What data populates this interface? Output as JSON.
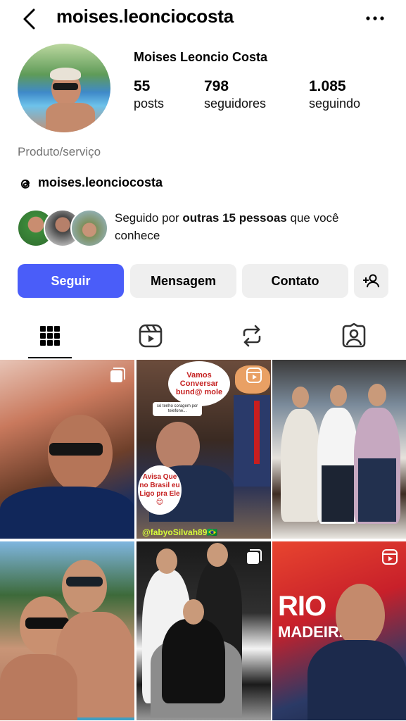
{
  "header": {
    "username": "moises.leonciocosta",
    "back_icon": "chevron-left-icon",
    "more_icon": "more-horizontal-icon"
  },
  "profile": {
    "full_name": "Moises Leoncio Costa",
    "stats": [
      {
        "value": "55",
        "label": "posts"
      },
      {
        "value": "798",
        "label": "seguidores"
      },
      {
        "value": "1.085",
        "label": "seguindo"
      }
    ],
    "category": "Produto/serviço",
    "threads_handle": "moises.leonciocosta",
    "followed_by": {
      "prefix": "Seguido por ",
      "bold": "outras 15 pessoas",
      "suffix": " que você conhece"
    }
  },
  "buttons": {
    "follow": "Seguir",
    "message": "Mensagem",
    "contact": "Contato",
    "add_user_icon": "add-user-icon"
  },
  "tabs": [
    "grid-icon",
    "reels-icon",
    "reposts-icon",
    "tagged-icon"
  ],
  "posts": {
    "post2": {
      "bubble_top": "Vamos Conversar bund@ mole",
      "note": "só tenho coragem por telefone...",
      "bubble_bottom": "Avisa Que no Brasil eu Ligo pra Ele😊",
      "watermark": "@fabyoSilvah89🇧🇷"
    },
    "post6": {
      "logo_line1": "RIO",
      "logo_line2": "MADEIRA FM"
    }
  },
  "colors": {
    "accent": "#4a5df9",
    "button_gray": "#efefef",
    "muted": "#737373"
  }
}
